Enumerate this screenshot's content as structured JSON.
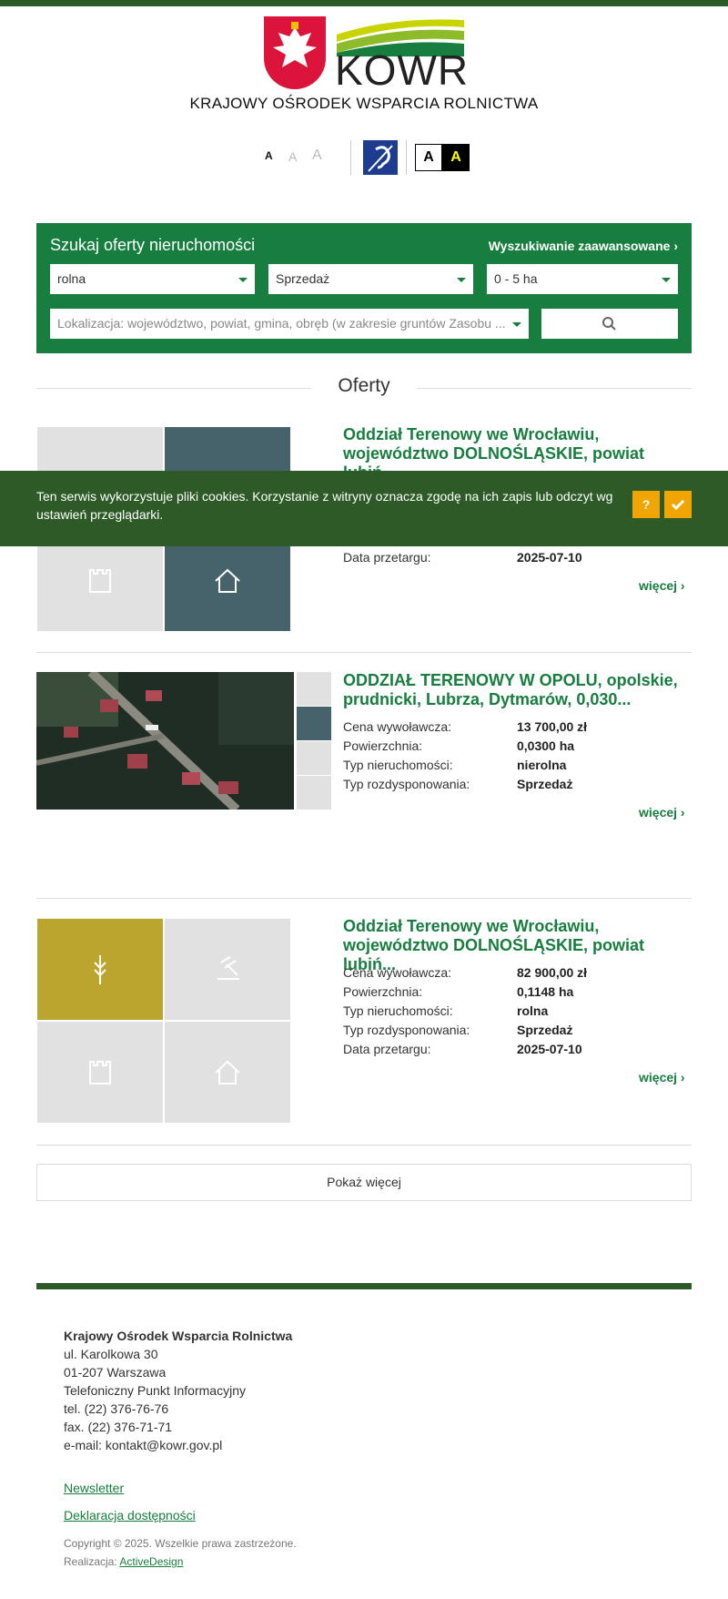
{
  "header": {
    "org_name": "KRAJOWY OŚRODEK WSPARCIA ROLNICTWA",
    "logo_text": "KOWR",
    "font_sizes": [
      "A",
      "A",
      "A"
    ],
    "contrast": [
      "A",
      "A"
    ],
    "sign_language_icon": "ear-icon"
  },
  "search": {
    "title": "Szukaj oferty nieruchomości",
    "advanced": "Wyszukiwanie zaawansowane",
    "type": "rolna",
    "mode": "Sprzedaż",
    "area": "0 - 5 ha",
    "location_placeholder": "Lokalizacja: województwo, powiat, gmina, obręb (w zakresie gruntów Zasobu ..."
  },
  "offers_title": "Oferty",
  "offers": [
    {
      "title": "Oddział Terenowy we Wrocławiu, województwo DOLNOŚLĄSKIE, powiat lubiń...",
      "rows": [
        {
          "label": "Data przetargu:",
          "value": "2025-07-10"
        }
      ],
      "more": "więcej"
    },
    {
      "title": "ODDZIAŁ TERENOWY W OPOLU, opolskie, prudnicki, Lubrza, Dytmarów, 0,030...",
      "rows": [
        {
          "label": "Cena wywoławcza:",
          "value": "13 700,00 zł"
        },
        {
          "label": "Powierzchnia:",
          "value": "0,0300 ha"
        },
        {
          "label": "Typ nieruchomości:",
          "value": "nierolna"
        },
        {
          "label": "Typ rozdysponowania:",
          "value": "Sprzedaż"
        }
      ],
      "more": "więcej"
    },
    {
      "title": "Oddział Terenowy we Wrocławiu, województwo DOLNOŚLĄSKIE, powiat lubiń...",
      "rows": [
        {
          "label": "Cena wywoławcza:",
          "value": "82 900,00 zł"
        },
        {
          "label": "Powierzchnia:",
          "value": "0,1148 ha"
        },
        {
          "label": "Typ nieruchomości:",
          "value": "rolna"
        },
        {
          "label": "Typ rozdysponowania:",
          "value": "Sprzedaż"
        },
        {
          "label": "Data przetargu:",
          "value": "2025-07-10"
        }
      ],
      "more": "więcej"
    }
  ],
  "cookie": {
    "text": "Ten serwis wykorzystuje pliki cookies. Korzystanie z witryny oznacza zgodę na ich zapis lub odczyt wg ustawień przeglądarki.",
    "help": "?"
  },
  "show_more": "Pokaż więcej",
  "footer": {
    "name": "Krajowy Ośrodek Wsparcia Rolnictwa",
    "lines": [
      "ul. Karolkowa 30",
      "01-207 Warszawa",
      "Telefoniczny Punkt Informacyjny",
      "tel. (22) 376-76-76",
      "fax. (22) 376-71-71",
      "e-mail: kontakt@kowr.gov.pl"
    ],
    "newsletter": "Newsletter",
    "accessibility": "Deklaracja dostępności",
    "copyright": "Copyright © 2025. Wszelkie prawa zastrzeżone.",
    "realization_label": "Realizacja:",
    "realization_link": "ActiveDesign"
  },
  "colors": {
    "green": "#177e3f",
    "dark_green": "#2d5a27",
    "gold": "#bca52e",
    "slate": "#46636c",
    "cookie_btn": "#f0a500"
  }
}
